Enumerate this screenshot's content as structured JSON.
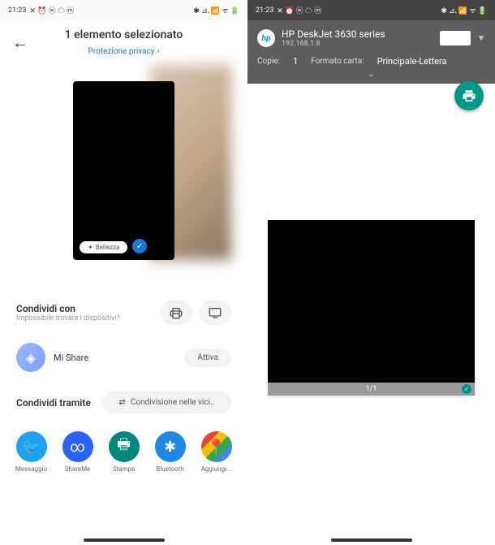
{
  "statusBar": {
    "time": "21:23",
    "leftIcons": "✕ ⏰ ⓦ ☁ ⓜ",
    "rightIcons": "✱ ⊿᎐ 📶 ᯤ 🔋"
  },
  "left": {
    "headerTitle": "1 elemento selezionato",
    "headerSubtitle": "Protezione privacy",
    "bellezzaLabel": "Bellezza",
    "shareWith": {
      "title": "Condividi con",
      "subtitle": "Impossibile trovare i dispositivi?"
    },
    "miShare": {
      "label": "Mi Share",
      "action": "Attiva"
    },
    "shareVia": {
      "title": "Condividi tramite",
      "nearbyLabel": "Condivisione nelle vici..",
      "nearbyIcon": "⇄"
    },
    "apps": [
      {
        "label": "Messaggio",
        "iconClass": "twitter",
        "glyph": "🐦"
      },
      {
        "label": "ShareMe",
        "iconClass": "shareme",
        "glyph": "∞"
      },
      {
        "label": "Stampa",
        "iconClass": "stampa",
        "glyph": "🖶"
      },
      {
        "label": "Bluetooth",
        "iconClass": "bluetooth",
        "glyph": "✱"
      },
      {
        "label": "Aggiungi...",
        "iconClass": "gmaps",
        "glyph": "📍"
      }
    ]
  },
  "right": {
    "printerName": "HP DeskJet 3630 series",
    "printerIp": "192.168.1.8",
    "copiesLabel": "Copie:",
    "copiesValue": "1",
    "formatLabel": "Formato carta:",
    "formatValue": "Principale-Lettera",
    "pageCounter": "1/1"
  }
}
